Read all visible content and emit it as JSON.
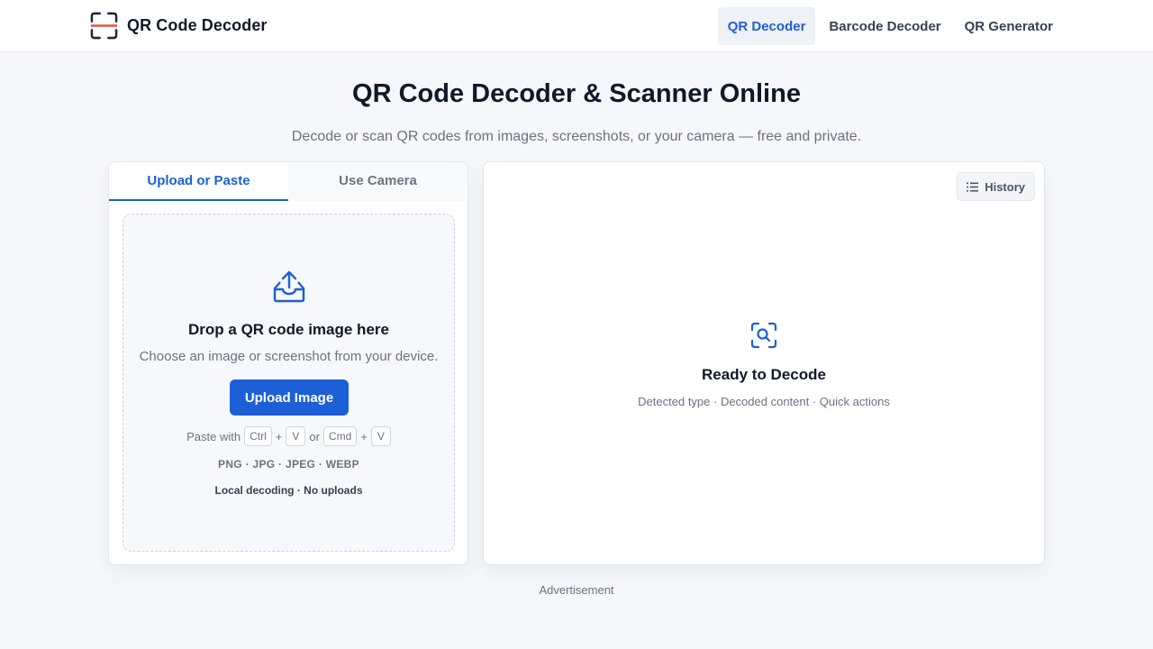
{
  "header": {
    "brand_name": "QR Code Decoder",
    "nav": [
      {
        "label": "QR Decoder",
        "active": true
      },
      {
        "label": "Barcode Decoder",
        "active": false
      },
      {
        "label": "QR Generator",
        "active": false
      }
    ]
  },
  "hero": {
    "title": "QR Code Decoder & Scanner Online",
    "subtitle": "Decode or scan QR codes from images, screenshots, or your camera — free and private."
  },
  "input_panel": {
    "tabs": [
      {
        "label": "Upload or Paste",
        "active": true
      },
      {
        "label": "Use Camera",
        "active": false
      }
    ],
    "dropzone": {
      "title": "Drop a QR code image here",
      "subtitle": "Choose an image or screenshot from your device.",
      "upload_button": "Upload Image",
      "paste_prefix": "Paste with",
      "paste_plus": "+",
      "paste_or": "or",
      "keys": [
        "Ctrl",
        "V",
        "Cmd",
        "V"
      ],
      "formats": "PNG · JPG · JPEG · WEBP",
      "privacy": "Local decoding · No uploads"
    }
  },
  "result_panel": {
    "history_label": "History",
    "ready_title": "Ready to Decode",
    "ready_subtitle": "Detected type · Decoded content · Quick actions"
  },
  "footer": {
    "ad_label": "Advertisement"
  },
  "colors": {
    "accent": "#1d5fd6",
    "brand_scan_line": "#e5533d",
    "page_background": "#f5f7fb"
  },
  "icons": {
    "brand": "qr-scan-frame-icon",
    "upload": "inbox-upload-icon",
    "history": "list-icon",
    "ready": "scan-search-icon"
  }
}
